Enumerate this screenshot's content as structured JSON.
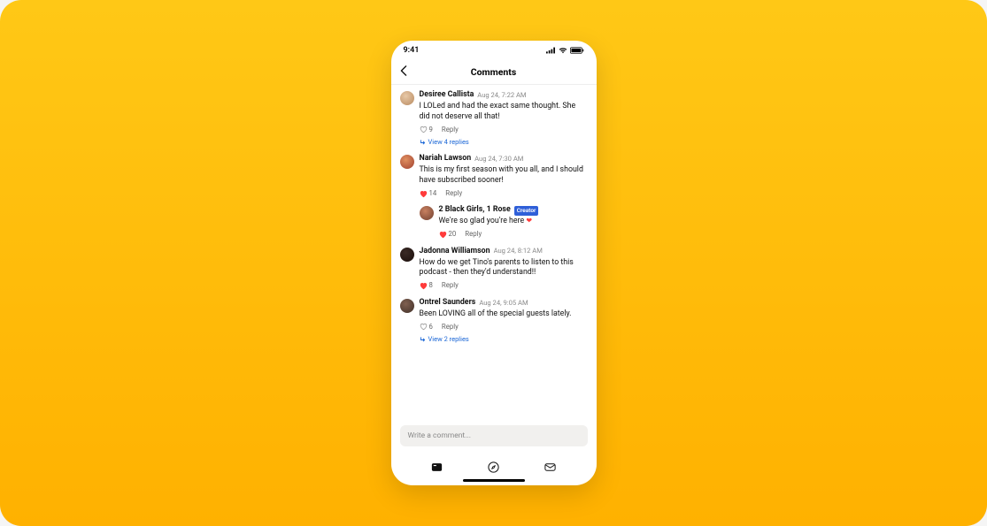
{
  "status": {
    "time": "9:41"
  },
  "nav": {
    "title": "Comments"
  },
  "comments": [
    {
      "author": "Desiree Callista",
      "ts": "Aug 24, 7:22 AM",
      "text": "I LOLed and had the exact same thought. She did not deserve all that!",
      "likes": "9",
      "liked": false,
      "reply_label": "Reply",
      "view_replies": "View 4 replies"
    },
    {
      "author": "Nariah Lawson",
      "ts": "Aug 24, 7:30 AM",
      "text": "This is my first season with you all, and I should have subscribed sooner!",
      "likes": "14",
      "liked": true,
      "reply_label": "Reply"
    },
    {
      "author": "2 Black Girls, 1 Rose",
      "badge": "Creator",
      "text_pre": "We're so glad you're here ",
      "likes": "20",
      "liked": true,
      "reply_label": "Reply",
      "nested": true
    },
    {
      "author": "Jadonna Williamson",
      "ts": "Aug 24, 8:12 AM",
      "text": "How do we get Tino's parents to listen to this podcast - then they'd understand!!",
      "likes": "8",
      "liked": true,
      "reply_label": "Reply"
    },
    {
      "author": "Ontrel Saunders",
      "ts": "Aug 24, 9:05 AM",
      "text": "Been LOVING all of the special guests lately.",
      "likes": "6",
      "liked": false,
      "reply_label": "Reply",
      "view_replies": "View 2 replies"
    }
  ],
  "composer": {
    "placeholder": "Write a comment..."
  }
}
